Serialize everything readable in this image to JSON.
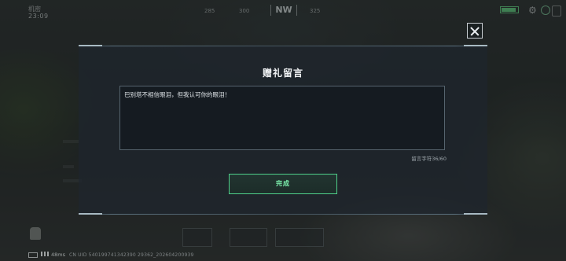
{
  "hud": {
    "area_label": "机密",
    "time": "23:09",
    "compass_left": "285",
    "compass_mid_left": "300",
    "compass_heading": "NW",
    "compass_right": "325",
    "status_text": "",
    "ping": "48ms",
    "uid": "CN UID 540199741342390 29362_202604200939"
  },
  "dialog": {
    "title": "赠礼留言",
    "message": "巴别塔不相信眼泪，但我认可你的眼泪！",
    "char_count": "留言字符36/60",
    "done_label": "完成"
  },
  "icons": {
    "close": "close-icon",
    "settings": "gear-icon",
    "battery": "battery-icon",
    "signal": "signal-icon",
    "bag": "backpack-icon"
  },
  "colors": {
    "accent_green": "#4fd08a",
    "done_text": "#7df0ae",
    "panel_bg": "#1e262e"
  }
}
